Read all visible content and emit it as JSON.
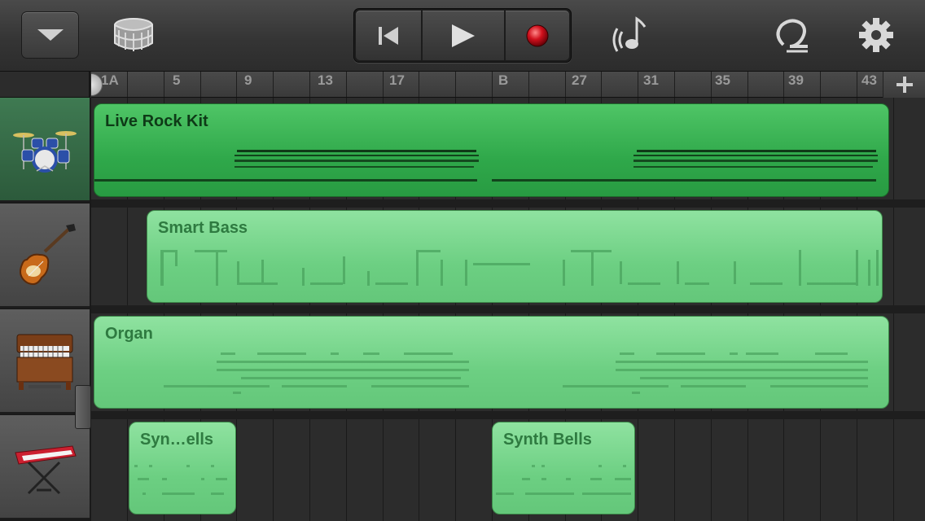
{
  "toolbar": {
    "menu_icon": "chevron-down-icon",
    "instrument_icon": "drum-icon",
    "rewind_icon": "rewind-to-start-icon",
    "play_icon": "play-icon",
    "record_icon": "record-icon",
    "metronome_icon": "metronome-icon",
    "loop_icon": "loop-browser-icon",
    "settings_icon": "gear-icon"
  },
  "ruler": {
    "labels": [
      "1A",
      "5",
      "9",
      "13",
      "17",
      "B",
      "27",
      "31",
      "35",
      "39",
      "43"
    ],
    "add_label": "+"
  },
  "tracks": [
    {
      "name": "Live Rock Kit",
      "icon": "drum-kit-icon",
      "selected": true
    },
    {
      "name": "Smart Bass",
      "icon": "bass-guitar-icon",
      "selected": false
    },
    {
      "name": "Organ",
      "icon": "organ-icon",
      "selected": false
    },
    {
      "name": "Synth Bells",
      "icon": "keyboard-icon",
      "selected": false
    }
  ],
  "regions": [
    {
      "track": 0,
      "label": "Live Rock Kit",
      "active": true
    },
    {
      "track": 1,
      "label": "Smart Bass",
      "active": false
    },
    {
      "track": 2,
      "label": "Organ",
      "active": false
    },
    {
      "track": 3,
      "label": "Syn…ells",
      "active": false
    },
    {
      "track": 3,
      "label": "Synth Bells",
      "active": false
    }
  ],
  "colors": {
    "region_active": "#2fa84a",
    "region_inactive": "#6ccf82",
    "record": "#d0101c"
  }
}
